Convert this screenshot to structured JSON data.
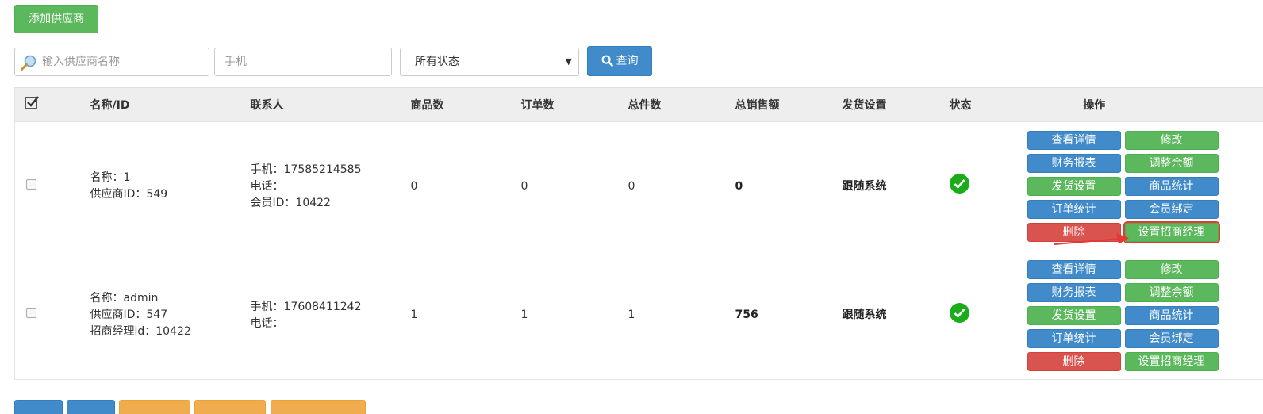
{
  "toolbar": {
    "add_label": "添加供应商"
  },
  "search": {
    "name_placeholder": "输入供应商名称",
    "phone_placeholder": "手机",
    "status_value": "所有状态",
    "query_label": "查询",
    "icons": {
      "name": "magnifier-icon",
      "query": "search-icon"
    }
  },
  "table": {
    "headers": [
      "名称/ID",
      "联系人",
      "商品数",
      "订单数",
      "总件数",
      "总销售额",
      "发货设置",
      "状态",
      "操作"
    ],
    "rows": [
      {
        "name": "名称：1",
        "supplier_id": "供应商ID：549",
        "manager": "",
        "phone": "手机：17585214585",
        "tel": "电话：",
        "member_id": "会员ID：10422",
        "goods": "0",
        "orders": "0",
        "items": "0",
        "sales": "0",
        "ship": "跟随系统",
        "status_icon": "check-circle-icon"
      },
      {
        "name": "名称：admin",
        "supplier_id": "供应商ID：547",
        "manager": "招商经理id：10422",
        "phone": "手机：17608411242",
        "tel": "电话：",
        "member_id": "",
        "goods": "1",
        "orders": "1",
        "items": "1",
        "sales": "756",
        "ship": "跟随系统",
        "status_icon": "check-circle-icon"
      }
    ],
    "actions": [
      "查看详情",
      "修改",
      "财务报表",
      "调整余额",
      "发货设置",
      "商品统计",
      "订单统计",
      "会员绑定",
      "删除",
      "设置招商经理"
    ]
  },
  "colors": {
    "green": "#5cb85c",
    "blue": "#428bca",
    "red": "#d9534f",
    "orange": "#f0ad4e",
    "highlight": "#e53935"
  }
}
